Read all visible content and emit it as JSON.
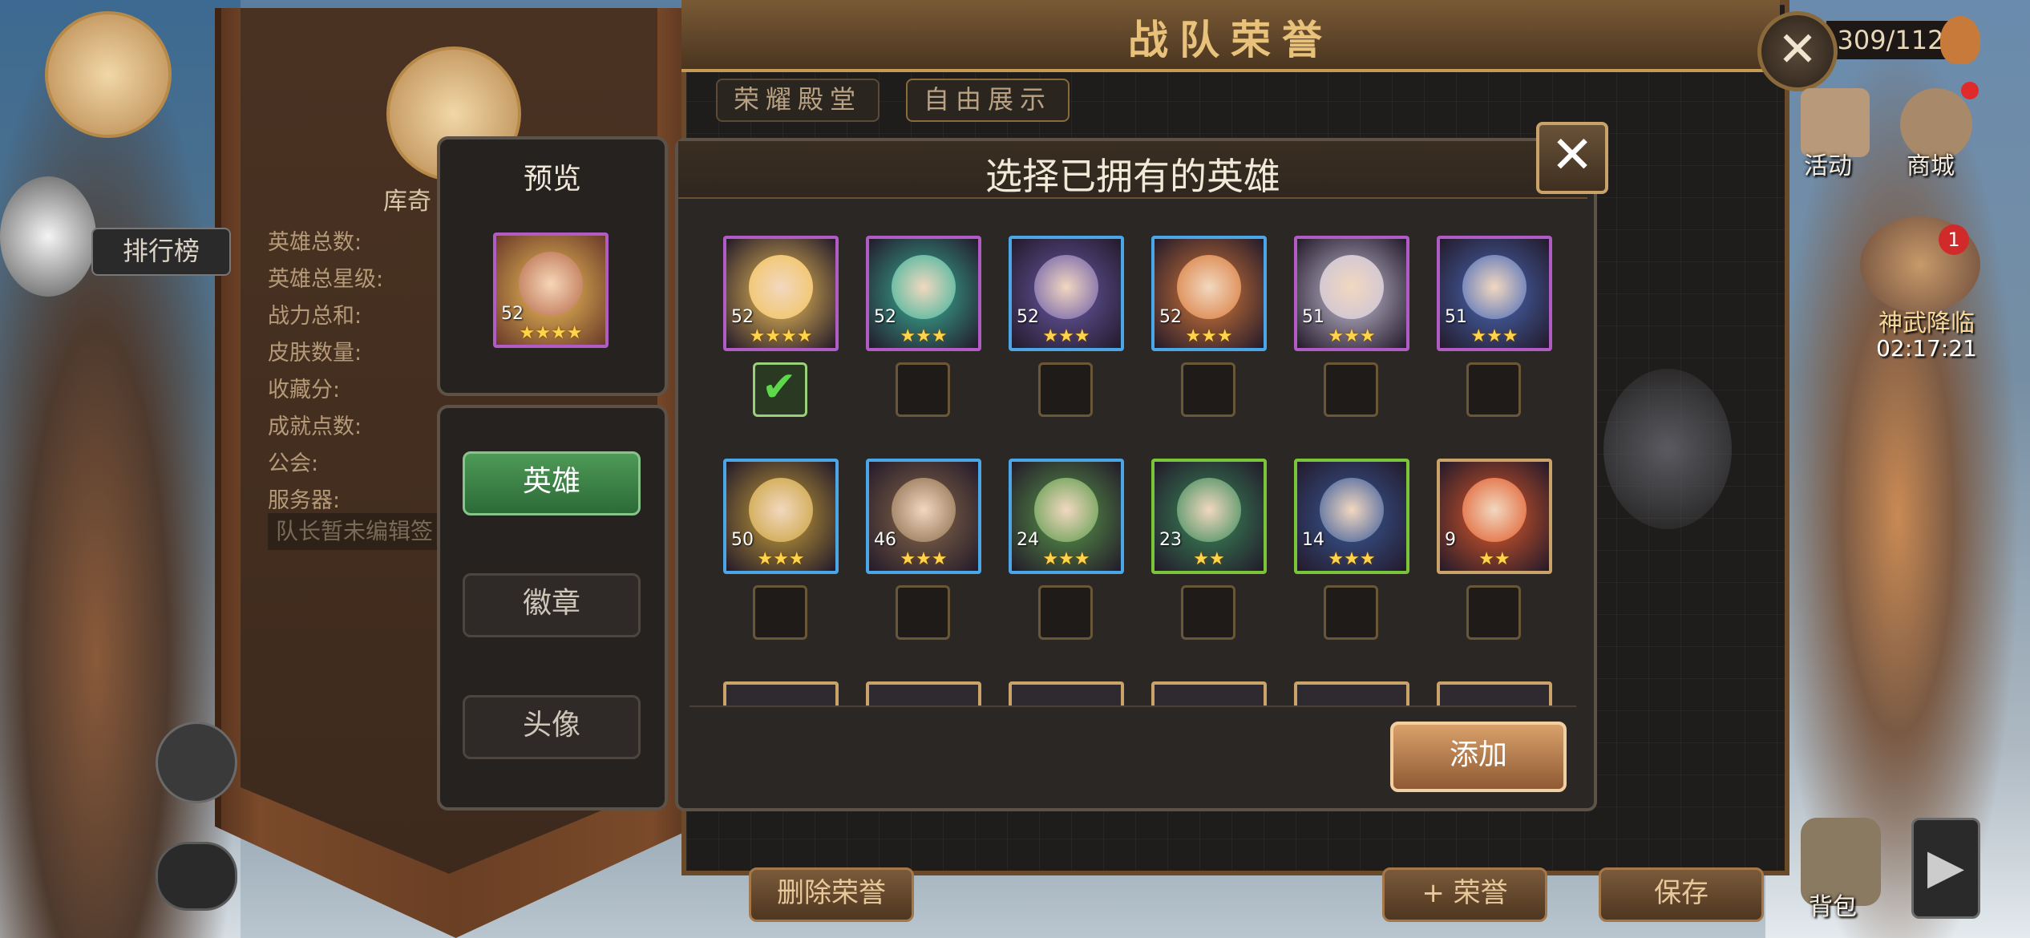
{
  "header": {
    "title": "战队荣誉",
    "counter": "309/112"
  },
  "top_tabs": [
    "荣耀殿堂",
    "自由展示"
  ],
  "left_panel": {
    "player_name": "库奇",
    "rank_button": "排行榜",
    "stats_labels": [
      "英雄总数:",
      "英雄总星级:",
      "战力总和:",
      "皮肤数量:",
      "收藏分:",
      "成就点数:",
      "公会:",
      "服务器:"
    ],
    "motto_placeholder": "队长暂未编辑签"
  },
  "right_side": {
    "activity": "活动",
    "shop": "商城",
    "event": "神武降临",
    "timer": "02:17:21",
    "badge": "1",
    "bag": "背包"
  },
  "bottom_buttons": {
    "delete": "删除荣誉",
    "add_honor": "+ 荣誉",
    "save": "保存"
  },
  "preview": {
    "title": "预览",
    "hero_level": "52",
    "hero_stars": "★★★★"
  },
  "menu": {
    "items": [
      "英雄",
      "徽章",
      "头像"
    ],
    "active": 0
  },
  "dialog": {
    "title": "选择已拥有的英雄",
    "add_button": "添加",
    "heroes": [
      {
        "level": "52",
        "stars": "★★★★",
        "selected": true,
        "frame": "#b05cc4",
        "color": "#f2c25a"
      },
      {
        "level": "52",
        "stars": "★★★",
        "selected": false,
        "frame": "#b05cc4",
        "color": "#3ab39a"
      },
      {
        "level": "52",
        "stars": "★★★",
        "selected": false,
        "frame": "#4aa6e6",
        "color": "#6a5aa8"
      },
      {
        "level": "52",
        "stars": "★★★",
        "selected": false,
        "frame": "#4aa6e6",
        "color": "#d87a3a"
      },
      {
        "level": "51",
        "stars": "★★★",
        "selected": false,
        "frame": "#b05cc4",
        "color": "#c8c2d8"
      },
      {
        "level": "51",
        "stars": "★★★",
        "selected": false,
        "frame": "#b05cc4",
        "color": "#4a6ab8"
      },
      {
        "level": "50",
        "stars": "★★★",
        "selected": false,
        "frame": "#4aa6e6",
        "color": "#c9a13a"
      },
      {
        "level": "46",
        "stars": "★★★",
        "selected": false,
        "frame": "#4aa6e6",
        "color": "#8a6a4a"
      },
      {
        "level": "24",
        "stars": "★★★",
        "selected": false,
        "frame": "#4aa6e6",
        "color": "#5a9a4a"
      },
      {
        "level": "23",
        "stars": "★★",
        "selected": false,
        "frame": "#7ac43a",
        "color": "#3a8a5a"
      },
      {
        "level": "14",
        "stars": "★★★",
        "selected": false,
        "frame": "#7ac43a",
        "color": "#3a5a9a"
      },
      {
        "level": "9",
        "stars": "★★",
        "selected": false,
        "frame": "#c9a36a",
        "color": "#e05a2a"
      }
    ]
  },
  "colors": {
    "accent": "#c9a36a",
    "active_green": "#3c8a47"
  }
}
